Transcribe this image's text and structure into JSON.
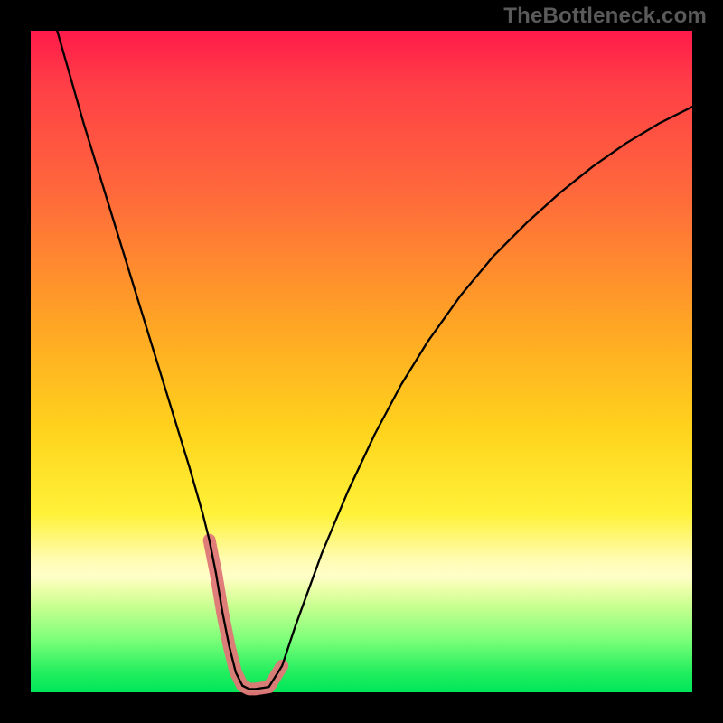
{
  "watermark": "TheBottleneck.com",
  "colors": {
    "page_bg": "#000000",
    "curve": "#000000",
    "accent": "#e07878",
    "watermark_text": "#5a5a5a"
  },
  "chart_data": {
    "type": "line",
    "title": "",
    "xlabel": "",
    "ylabel": "",
    "xlim": [
      0,
      100
    ],
    "ylim": [
      0,
      100
    ],
    "grid": false,
    "legend": false,
    "series": [
      {
        "name": "bottleneck-curve",
        "x": [
          4,
          6,
          8,
          10,
          12,
          14,
          16,
          18,
          20,
          22,
          24,
          26,
          27,
          28,
          29,
          30,
          31,
          32,
          33,
          34,
          36,
          38,
          40,
          44,
          48,
          52,
          56,
          60,
          65,
          70,
          75,
          80,
          85,
          90,
          95,
          100
        ],
        "y": [
          100,
          93,
          86,
          79.5,
          73,
          66.5,
          60,
          53.5,
          47,
          40.5,
          34,
          27,
          23,
          18,
          12,
          7,
          3,
          1,
          0.5,
          0.5,
          0.8,
          4,
          10,
          21,
          30.5,
          39,
          46.5,
          53,
          60,
          66,
          71,
          75.5,
          79.5,
          83,
          86,
          88.5
        ]
      },
      {
        "name": "accent-segment",
        "x": [
          27,
          28,
          29,
          30,
          31,
          32,
          33,
          34,
          36,
          38
        ],
        "y": [
          23,
          18,
          12,
          7,
          3,
          1,
          0.5,
          0.5,
          0.8,
          4
        ]
      }
    ]
  }
}
